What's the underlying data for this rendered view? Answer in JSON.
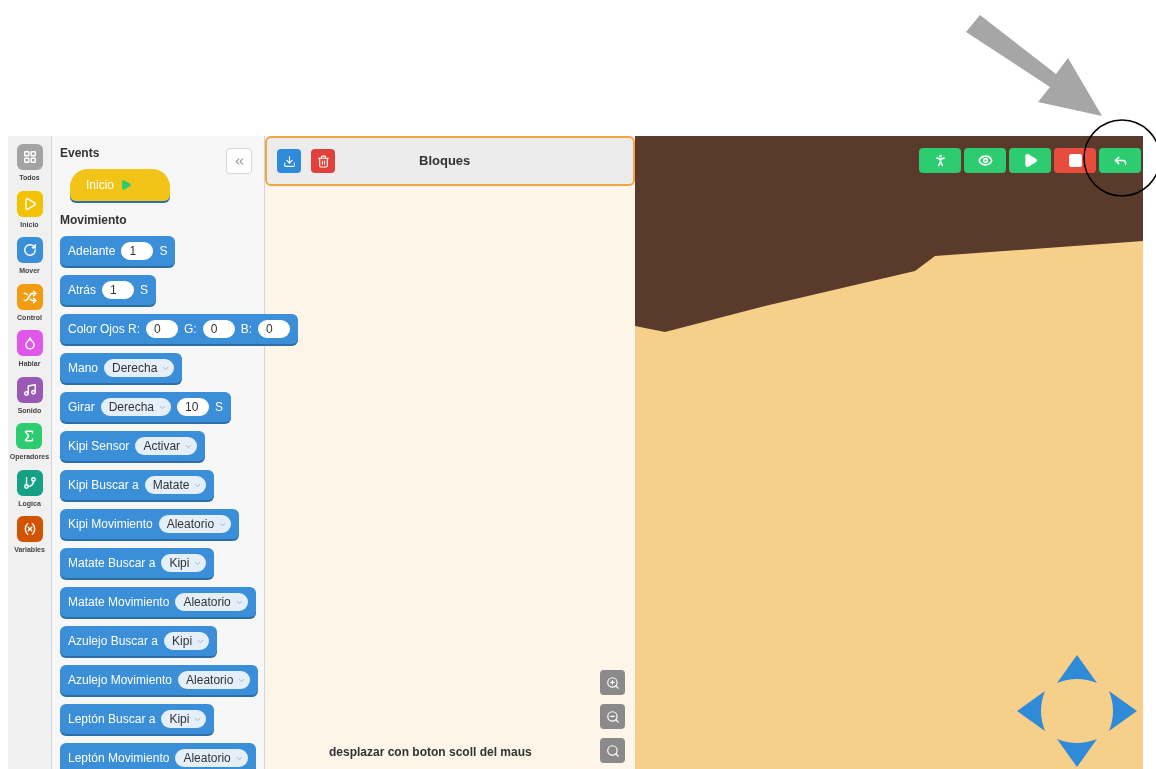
{
  "categories": [
    {
      "label": "Todos",
      "kind": "grid",
      "color": "#a3a3a3"
    },
    {
      "label": "Inicio",
      "kind": "play",
      "color": "#f2c200"
    },
    {
      "label": "Mover",
      "kind": "rotate",
      "color": "#3b8fd9"
    },
    {
      "label": "Control",
      "kind": "shuffle",
      "color": "#f39c12"
    },
    {
      "label": "Hablar",
      "kind": "drop",
      "color": "#e056e8"
    },
    {
      "label": "Sonido",
      "kind": "note",
      "color": "#9b59b6"
    },
    {
      "label": "Operadores",
      "kind": "sigma",
      "color": "#2ecc71"
    },
    {
      "label": "Logica",
      "kind": "branch",
      "color": "#16a085"
    },
    {
      "label": "Variables",
      "kind": "variable",
      "color": "#d35400"
    }
  ],
  "palette": {
    "sections": [
      {
        "title": "Events",
        "blocks": [
          {
            "kind": "event",
            "parts": [
              {
                "kind": "text",
                "text": "Inicio"
              },
              {
                "kind": "play"
              }
            ]
          }
        ]
      },
      {
        "title": "Movimiento",
        "blocks": [
          {
            "kind": "command",
            "parts": [
              {
                "kind": "text",
                "text": "Adelante"
              },
              {
                "kind": "number",
                "text": "1"
              },
              {
                "kind": "text",
                "text": "S"
              }
            ]
          },
          {
            "kind": "command",
            "parts": [
              {
                "kind": "text",
                "text": "Atrás"
              },
              {
                "kind": "number",
                "text": "1"
              },
              {
                "kind": "text",
                "text": "S"
              }
            ]
          },
          {
            "kind": "command",
            "parts": [
              {
                "kind": "text",
                "text": "Color Ojos R:"
              },
              {
                "kind": "number",
                "text": "0"
              },
              {
                "kind": "text",
                "text": "G:"
              },
              {
                "kind": "number",
                "text": "0"
              },
              {
                "kind": "text",
                "text": "B:"
              },
              {
                "kind": "number",
                "text": "0"
              }
            ]
          },
          {
            "kind": "command",
            "parts": [
              {
                "kind": "text",
                "text": "Mano"
              },
              {
                "kind": "dropdown",
                "text": "Derecha"
              }
            ]
          },
          {
            "kind": "command",
            "parts": [
              {
                "kind": "text",
                "text": "Girar"
              },
              {
                "kind": "dropdown",
                "text": "Derecha"
              },
              {
                "kind": "number",
                "text": "10"
              },
              {
                "kind": "text",
                "text": "S"
              }
            ]
          },
          {
            "kind": "command",
            "parts": [
              {
                "kind": "text",
                "text": "Kipi Sensor"
              },
              {
                "kind": "dropdown",
                "text": "Activar"
              }
            ]
          },
          {
            "kind": "command",
            "parts": [
              {
                "kind": "text",
                "text": "Kipi Buscar a"
              },
              {
                "kind": "dropdown",
                "text": "Matate"
              }
            ]
          },
          {
            "kind": "command",
            "parts": [
              {
                "kind": "text",
                "text": "Kipi Movimiento"
              },
              {
                "kind": "dropdown",
                "text": "Aleatorio"
              }
            ]
          },
          {
            "kind": "command",
            "parts": [
              {
                "kind": "text",
                "text": "Matate Buscar a"
              },
              {
                "kind": "dropdown",
                "text": "Kipi"
              }
            ]
          },
          {
            "kind": "command",
            "parts": [
              {
                "kind": "text",
                "text": "Matate Movimiento"
              },
              {
                "kind": "dropdown",
                "text": "Aleatorio"
              }
            ]
          },
          {
            "kind": "command",
            "parts": [
              {
                "kind": "text",
                "text": "Azulejo Buscar a"
              },
              {
                "kind": "dropdown",
                "text": "Kipi"
              }
            ]
          },
          {
            "kind": "command",
            "parts": [
              {
                "kind": "text",
                "text": "Azulejo Movimiento"
              },
              {
                "kind": "dropdown",
                "text": "Aleatorio"
              }
            ]
          },
          {
            "kind": "command",
            "parts": [
              {
                "kind": "text",
                "text": "Leptón Buscar a"
              },
              {
                "kind": "dropdown",
                "text": "Kipi"
              }
            ]
          },
          {
            "kind": "command",
            "parts": [
              {
                "kind": "text",
                "text": "Leptón Movimiento"
              },
              {
                "kind": "dropdown",
                "text": "Aleatorio"
              }
            ]
          }
        ]
      }
    ]
  },
  "workspace": {
    "title": "Bloques",
    "hint": "desplazar con boton scoll del maus"
  },
  "scene_toolbar": [
    {
      "kind": "run",
      "color": "#2ecc71"
    },
    {
      "kind": "view",
      "color": "#2ecc71"
    },
    {
      "kind": "play",
      "color": "#2ecc71"
    },
    {
      "kind": "stop",
      "color": "#e74c3c"
    },
    {
      "kind": "back",
      "color": "#2ecc71"
    }
  ]
}
